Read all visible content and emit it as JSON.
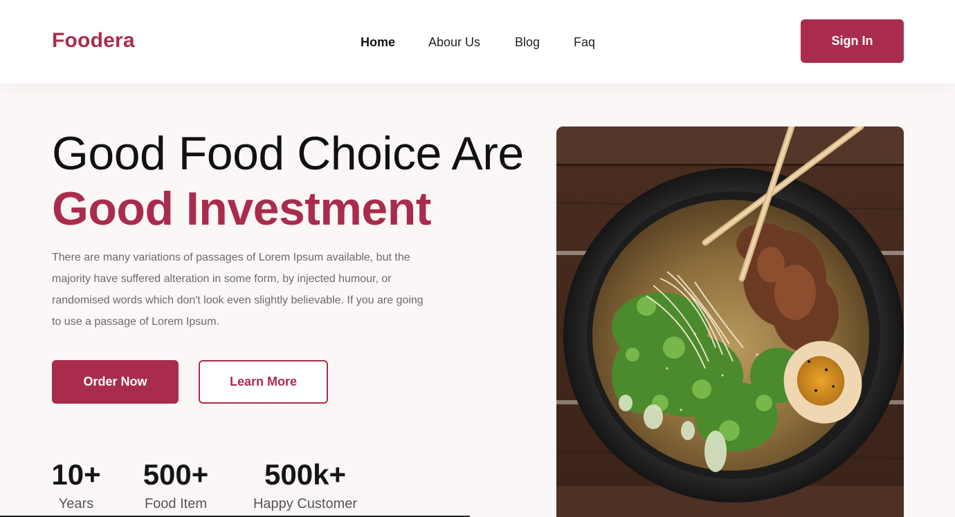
{
  "header": {
    "logo": "Foodera",
    "nav": [
      {
        "label": "Home",
        "active": true
      },
      {
        "label": "Abour Us",
        "active": false
      },
      {
        "label": "Blog",
        "active": false
      },
      {
        "label": "Faq",
        "active": false
      }
    ],
    "signin_label": "Sign In"
  },
  "hero": {
    "title_line1": "Good Food Choice Are",
    "title_line2": "Good Investment",
    "description": "There are many variations of passages of Lorem Ipsum available, but the majority have suffered alteration in some form, by injected humour, or randomised words which don't look even slightly believable. If you are going to use a passage of Lorem Ipsum.",
    "order_label": "Order Now",
    "learn_label": "Learn More"
  },
  "stats": [
    {
      "value": "10+",
      "label": "Years"
    },
    {
      "value": "500+",
      "label": "Food Item"
    },
    {
      "value": "500k+",
      "label": "Happy Customer"
    }
  ],
  "image": {
    "icon": "ramen-bowl-photo"
  },
  "colors": {
    "brand": "#a92c4c",
    "background": "#fbf7f6",
    "text": "#111111"
  }
}
